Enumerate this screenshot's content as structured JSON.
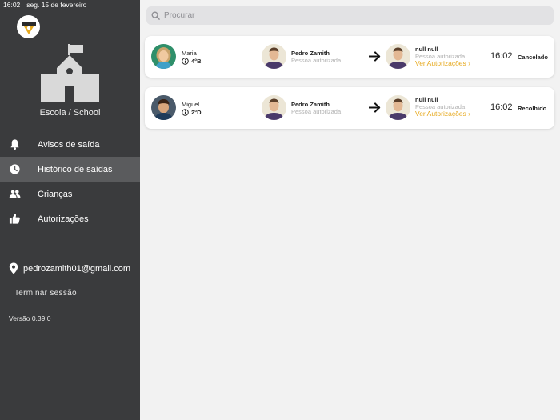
{
  "status_bar": {
    "time": "16:02",
    "date": "seg. 15 de fevereiro"
  },
  "sidebar": {
    "school_name": "Escola / School",
    "nav": [
      {
        "label": "Avisos de saída",
        "icon": "bell-icon",
        "active": false
      },
      {
        "label": "Histórico de saídas",
        "icon": "history-icon",
        "active": true
      },
      {
        "label": "Crianças",
        "icon": "people-icon",
        "active": false
      },
      {
        "label": "Autorizações",
        "icon": "thumbs-up-icon",
        "active": false
      }
    ],
    "user_email": "pedrozamith01@gmail.com",
    "logout_label": "Terminar sessão",
    "version": "Versão 0.39.0"
  },
  "search": {
    "placeholder": "Procurar"
  },
  "records": [
    {
      "child_name": "Maria",
      "child_class": "4°B",
      "from_name": "Pedro Zamith",
      "from_role": "Pessoa autorizada",
      "to_name": "null null",
      "to_role": "Pessoa autorizada",
      "view_auth": "Ver Autorizações",
      "time": "16:02",
      "state": "Cancelado"
    },
    {
      "child_name": "Miguel",
      "child_class": "2°D",
      "from_name": "Pedro Zamith",
      "from_role": "Pessoa autorizada",
      "to_name": "null null",
      "to_role": "Pessoa autorizada",
      "view_auth": "Ver Autorizações",
      "time": "16:02",
      "state": "Recolhido"
    }
  ],
  "colors": {
    "sidebar": "#3a3b3d",
    "accent": "#e6a91e",
    "active_nav": "#5a5b5d"
  }
}
